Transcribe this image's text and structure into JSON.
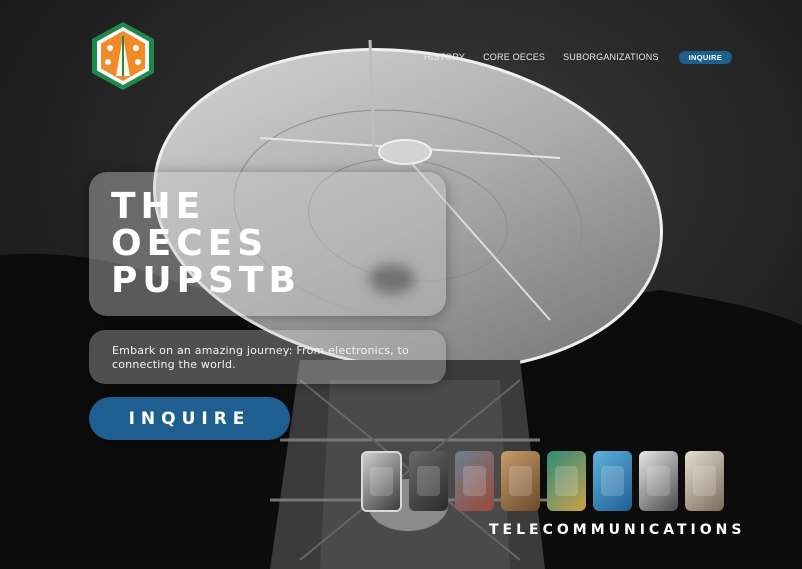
{
  "nav": {
    "links": [
      "HISTORY",
      "CORE OECES",
      "SUBORGANIZATIONS"
    ],
    "cta": "INQUIRE"
  },
  "hero": {
    "title_lines": [
      "THE",
      "OECES",
      "PUPSTB"
    ],
    "subtitle": "Embark on an amazing journey: From electronics, to connecting the world.",
    "cta": "INQUIRE"
  },
  "gallery": {
    "items": [
      {
        "name": "satellite-dish",
        "colors": [
          "#cfcfcf",
          "#3a3a3a"
        ]
      },
      {
        "name": "radio-tower",
        "colors": [
          "#6a6a6a",
          "#2a2a2a"
        ]
      },
      {
        "name": "circuit-tools",
        "colors": [
          "#6d7f8f",
          "#9a4a3a"
        ]
      },
      {
        "name": "library",
        "colors": [
          "#c69c6a",
          "#6a4a2a"
        ]
      },
      {
        "name": "circuit-board",
        "colors": [
          "#2f8a7a",
          "#c9a24a"
        ]
      },
      {
        "name": "arduino",
        "colors": [
          "#5fb0dc",
          "#1e5f94"
        ]
      },
      {
        "name": "robot",
        "colors": [
          "#e8e8e8",
          "#4a4a4a"
        ]
      },
      {
        "name": "resistors",
        "colors": [
          "#e4e0d2",
          "#7a6a5a"
        ]
      }
    ],
    "active_index": 0,
    "caption": "TELECOMMUNICATIONS"
  },
  "logo": {
    "icon": "oeces-hexagon-logo",
    "colors": [
      "#f28a2a",
      "#1e8a4a"
    ]
  }
}
